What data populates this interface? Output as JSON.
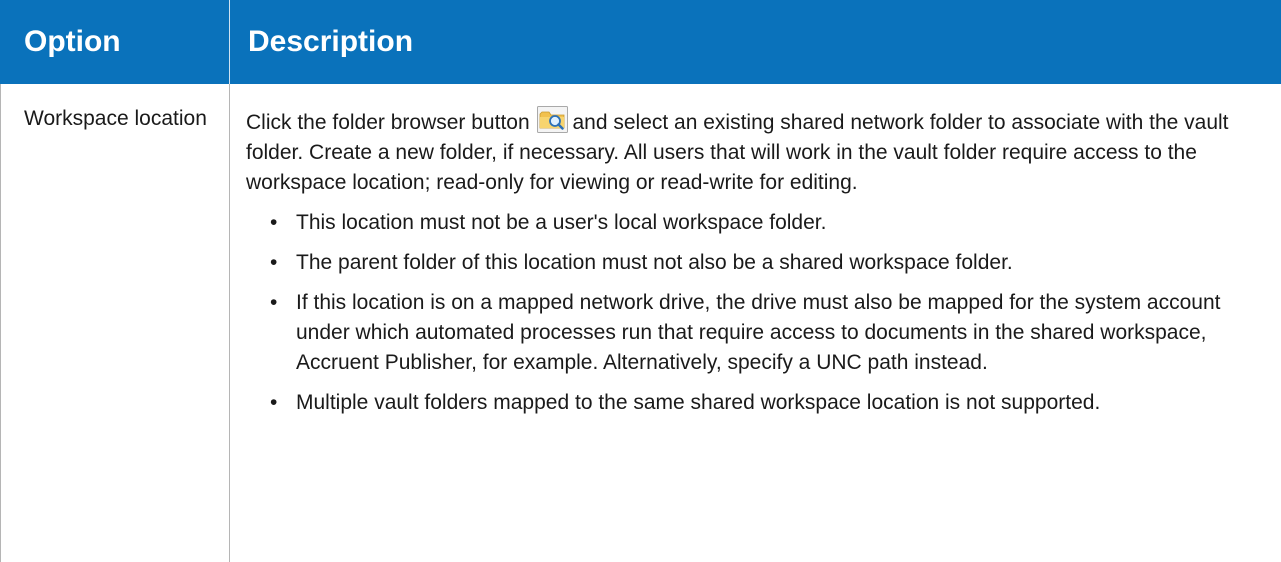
{
  "table": {
    "headers": {
      "option": "Option",
      "description": "Description"
    },
    "row": {
      "option": "Workspace location",
      "intro_before_icon": "Click the folder browser button",
      "intro_after_icon": "and select an existing shared network folder to associate with the vault folder. Create a new folder, if necessary. All users that will work in the vault folder require access to the workspace location; read-only for viewing or read-write for editing.",
      "bullets": [
        "This location must not be a user's local workspace folder.",
        "The parent folder of this location must not also be a shared workspace folder.",
        "If this location is on a mapped network drive, the drive must also be mapped for the system account under which automated processes run that require access to documents in the shared workspace, Accruent Publisher, for example. Alternatively, specify a UNC path instead.",
        "Multiple vault folders mapped to the same shared workspace location is not supported."
      ],
      "icon": "folder-browser-icon"
    }
  },
  "colors": {
    "header_bg": "#0a72bb",
    "header_text": "#ffffff",
    "grid": "#b5b5b5"
  }
}
